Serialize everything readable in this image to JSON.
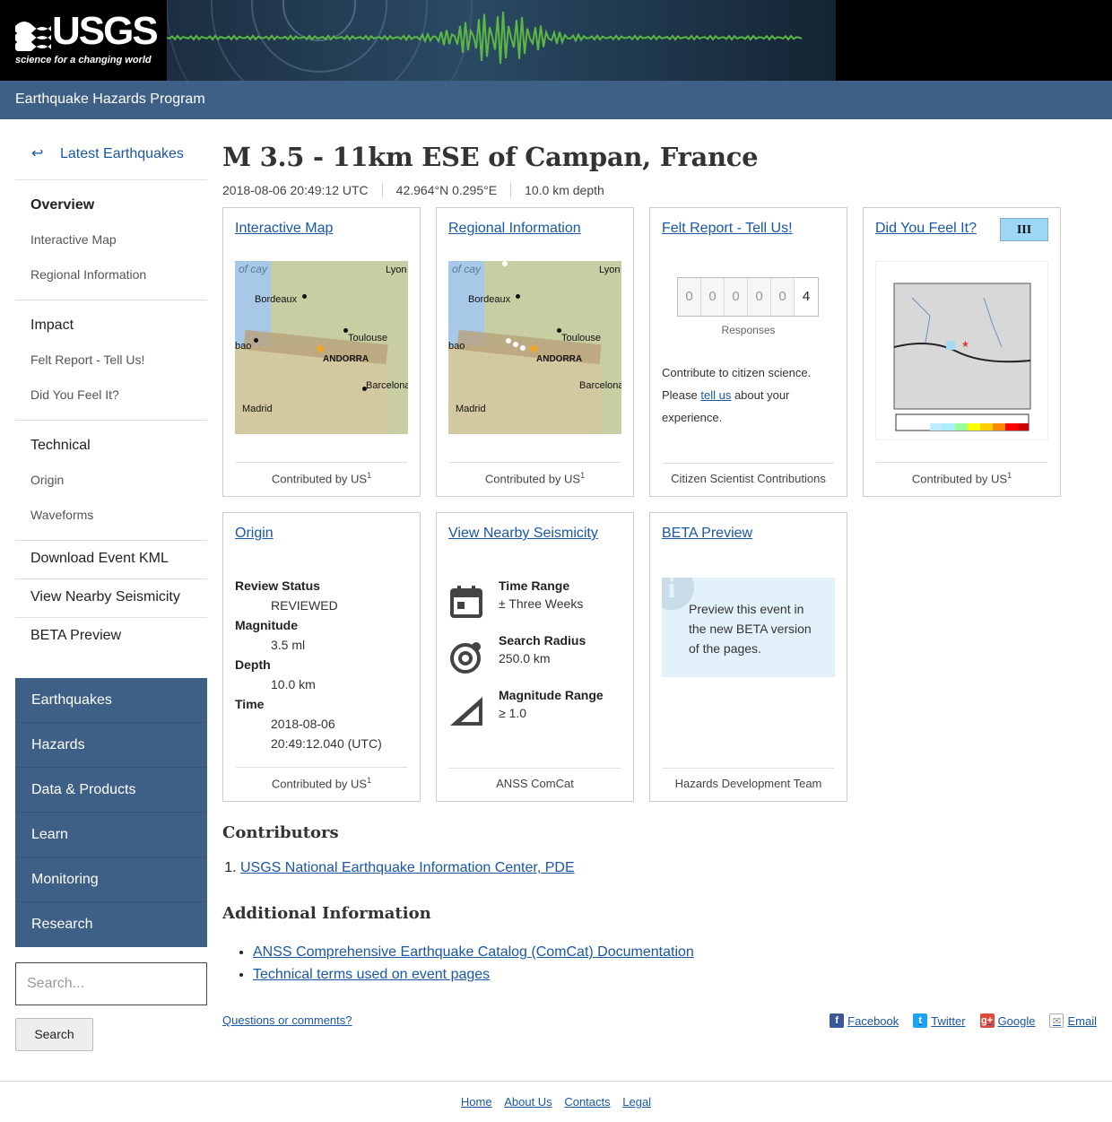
{
  "header": {
    "logo_text": "USGS",
    "logo_tagline": "science for a changing world",
    "program_title": "Earthquake Hazards Program"
  },
  "sidebar": {
    "back_link": "Latest Earthquakes",
    "overview": "Overview",
    "overview_items": [
      "Interactive Map",
      "Regional Information"
    ],
    "impact": "Impact",
    "impact_items": [
      "Felt Report - Tell Us!",
      "Did You Feel It?"
    ],
    "technical": "Technical",
    "technical_items": [
      "Origin",
      "Waveforms"
    ],
    "download_kml": "Download Event KML",
    "nearby": "View Nearby Seismicity",
    "beta": "BETA Preview",
    "site_nav": [
      "Earthquakes",
      "Hazards",
      "Data & Products",
      "Learn",
      "Monitoring",
      "Research"
    ],
    "search_placeholder": "Search...",
    "search_button": "Search"
  },
  "event": {
    "title": "M 3.5 - 11km ESE of Campan, France",
    "time": "2018-08-06 20:49:12 UTC",
    "location": "42.964°N  0.295°E",
    "depth": "10.0 km depth"
  },
  "cards": {
    "interactive_map": {
      "title": "Interactive Map",
      "foot": "Contributed by US",
      "sup": "1"
    },
    "regional": {
      "title": "Regional Information",
      "foot": "Contributed by US",
      "sup": "1"
    },
    "felt": {
      "title": "Felt Report - Tell Us!",
      "digits": [
        "0",
        "0",
        "0",
        "0",
        "0",
        "4"
      ],
      "responses": "Responses",
      "text_before": "Contribute to citizen science. Please ",
      "link": "tell us",
      "text_after": " about your experience.",
      "foot": "Citizen Scientist Contributions"
    },
    "dyfi": {
      "title": "Did You Feel It?",
      "mmi": "III",
      "foot": "Contributed by US",
      "sup": "1"
    },
    "origin": {
      "title": "Origin",
      "review_label": "Review Status",
      "review_value": "REVIEWED",
      "magnitude_label": "Magnitude",
      "magnitude_value": "3.5 ml",
      "depth_label": "Depth",
      "depth_value": "10.0 km",
      "time_label": "Time",
      "time_value_1": "2018-08-06",
      "time_value_2": "20:49:12.040 (UTC)",
      "foot": "Contributed by US",
      "sup": "1"
    },
    "nearby": {
      "title": "View Nearby Seismicity",
      "time_label": "Time Range",
      "time_value": "± Three Weeks",
      "radius_label": "Search Radius",
      "radius_value": "250.0 km",
      "mag_label": "Magnitude Range",
      "mag_value": "≥ 1.0",
      "foot": "ANSS ComCat"
    },
    "beta": {
      "title": "BETA Preview",
      "text": "Preview this event in the new BETA version of the pages.",
      "foot": "Hazards Development Team"
    }
  },
  "map_labels": {
    "sea": "of cay",
    "bordeaux": "Bordeaux",
    "lyon": "Lyon",
    "toulouse": "Toulouse",
    "bilbao": "bao",
    "andorra": "ANDORRA",
    "barcelona": "Barcelona",
    "madrid": "Madrid"
  },
  "contributors": {
    "heading": "Contributors",
    "items": [
      "USGS National Earthquake Information Center, PDE"
    ]
  },
  "additional": {
    "heading": "Additional Information",
    "items": [
      "ANSS Comprehensive Earthquake Catalog (ComCat) Documentation",
      "Technical terms used on event pages"
    ]
  },
  "share": {
    "questions": "Questions or comments?",
    "facebook": "Facebook",
    "twitter": "Twitter",
    "google": "Google",
    "email": "Email"
  },
  "footer": [
    "Home",
    "About Us",
    "Contacts",
    "Legal"
  ],
  "colors": {
    "program_bar": "#3e5f86",
    "link": "#1a57a5",
    "mmi_badge": "#9cd7f7",
    "beta_box": "#e3f1fa",
    "seismogram": "#5bb843"
  }
}
